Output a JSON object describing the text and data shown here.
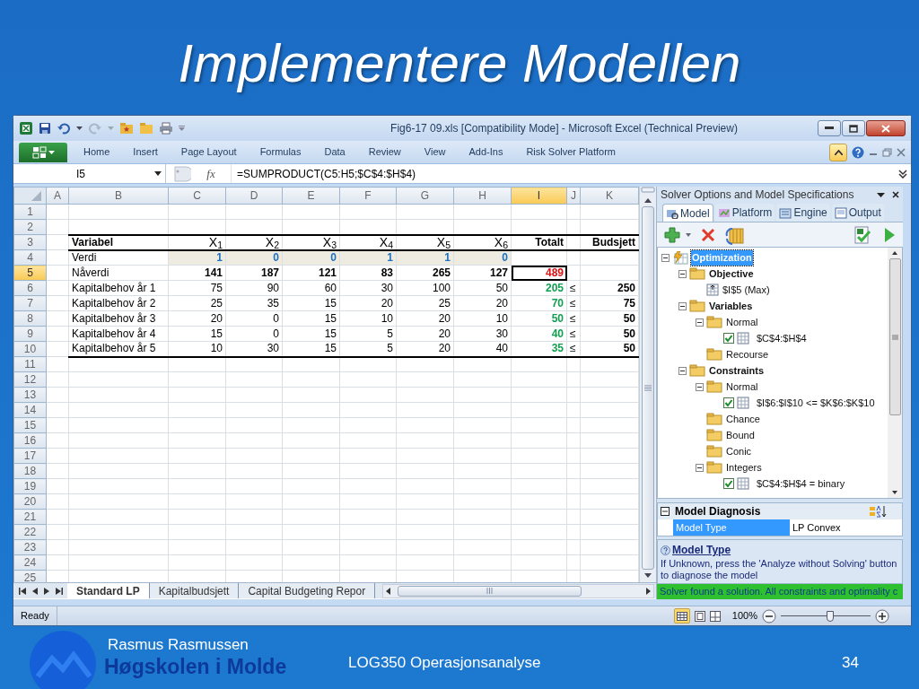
{
  "slide": {
    "title": "Implementere Modellen",
    "author": "Rasmus Rasmussen",
    "logo_text": "Høgskolen i Molde",
    "course": "LOG350 Operasjonsanalyse",
    "page_number": "34"
  },
  "window": {
    "title": "Fig6-17 09.xls  [Compatibility Mode]  -  Microsoft Excel (Technical Preview)"
  },
  "ribbon_tabs": [
    "Home",
    "Insert",
    "Page Layout",
    "Formulas",
    "Data",
    "Review",
    "View",
    "Add-Ins",
    "Risk Solver Platform"
  ],
  "formula_bar": {
    "name_box": "I5",
    "function_label": "fx",
    "formula": "=SUMPRODUCT(C5:H5;$C$4:$H$4)"
  },
  "sheet": {
    "columns": [
      {
        "label": "A",
        "selected": false
      },
      {
        "label": "B",
        "selected": false
      },
      {
        "label": "C",
        "selected": false
      },
      {
        "label": "D",
        "selected": false
      },
      {
        "label": "E",
        "selected": false
      },
      {
        "label": "F",
        "selected": false
      },
      {
        "label": "G",
        "selected": false
      },
      {
        "label": "H",
        "selected": false
      },
      {
        "label": "I",
        "selected": true
      },
      {
        "label": "J",
        "selected": false
      },
      {
        "label": "K",
        "selected": false
      }
    ],
    "rows": [
      {
        "number": "1",
        "selected": false,
        "kind": "empty"
      },
      {
        "number": "2",
        "selected": false,
        "kind": "empty"
      },
      {
        "number": "3",
        "selected": false,
        "kind": "header",
        "label": "Variabel",
        "values": [
          "X$_{1}$",
          "X$_{2}$",
          "X$_{3}$",
          "X$_{4}$",
          "X$_{5}$",
          "X$_{6}$"
        ],
        "total": "Totalt",
        "budget": "Budsjett"
      },
      {
        "number": "4",
        "selected": false,
        "kind": "input",
        "label": "Verdi",
        "values": [
          "1",
          "0",
          "0",
          "1",
          "1",
          "0"
        ]
      },
      {
        "number": "5",
        "selected": true,
        "kind": "objective",
        "label": "Nåverdi",
        "values": [
          "141",
          "187",
          "121",
          "83",
          "265",
          "127"
        ],
        "total": "489"
      },
      {
        "number": "6",
        "selected": false,
        "kind": "constraint",
        "label": "Kapitalbehov år 1",
        "values": [
          "75",
          "90",
          "60",
          "30",
          "100",
          "50"
        ],
        "total": "205",
        "sign": "≤",
        "budget": "250"
      },
      {
        "number": "7",
        "selected": false,
        "kind": "constraint",
        "label": "Kapitalbehov år 2",
        "values": [
          "25",
          "35",
          "15",
          "20",
          "25",
          "20"
        ],
        "total": "70",
        "sign": "≤",
        "budget": "75"
      },
      {
        "number": "8",
        "selected": false,
        "kind": "constraint",
        "label": "Kapitalbehov år 3",
        "values": [
          "20",
          "0",
          "15",
          "10",
          "20",
          "10"
        ],
        "total": "50",
        "sign": "≤",
        "budget": "50"
      },
      {
        "number": "9",
        "selected": false,
        "kind": "constraint",
        "label": "Kapitalbehov år 4",
        "values": [
          "15",
          "0",
          "15",
          "5",
          "20",
          "30"
        ],
        "total": "40",
        "sign": "≤",
        "budget": "50"
      },
      {
        "number": "10",
        "selected": false,
        "kind": "constraint",
        "label": "Kapitalbehov år 5",
        "values": [
          "10",
          "30",
          "15",
          "5",
          "20",
          "40"
        ],
        "total": "35",
        "sign": "≤",
        "budget": "50"
      },
      {
        "number": "11",
        "selected": false,
        "kind": "empty"
      },
      {
        "number": "12",
        "selected": false,
        "kind": "empty"
      },
      {
        "number": "13",
        "selected": false,
        "kind": "empty"
      },
      {
        "number": "14",
        "selected": false,
        "kind": "empty"
      },
      {
        "number": "15",
        "selected": false,
        "kind": "empty"
      },
      {
        "number": "16",
        "selected": false,
        "kind": "empty"
      },
      {
        "number": "17",
        "selected": false,
        "kind": "empty"
      },
      {
        "number": "18",
        "selected": false,
        "kind": "empty"
      },
      {
        "number": "19",
        "selected": false,
        "kind": "empty"
      },
      {
        "number": "20",
        "selected": false,
        "kind": "empty"
      },
      {
        "number": "21",
        "selected": false,
        "kind": "empty"
      },
      {
        "number": "22",
        "selected": false,
        "kind": "empty"
      },
      {
        "number": "23",
        "selected": false,
        "kind": "empty"
      },
      {
        "number": "24",
        "selected": false,
        "kind": "empty"
      },
      {
        "number": "25",
        "selected": false,
        "kind": "empty"
      }
    ],
    "sheet_tabs": [
      {
        "label": "Standard LP",
        "selected": true
      },
      {
        "label": "Kapitalbudsjett",
        "selected": false
      },
      {
        "label": "Capital Budgeting Repor",
        "selected": false
      }
    ]
  },
  "solver_panel": {
    "title": "Solver Options and Model Specifications",
    "tabs": [
      {
        "label": "Model",
        "selected": true
      },
      {
        "label": "Platform",
        "selected": false
      },
      {
        "label": "Engine",
        "selected": false
      },
      {
        "label": "Output",
        "selected": false
      }
    ],
    "tree": [
      {
        "label": "Optimization",
        "kind": "model",
        "selected": true,
        "expanded": true,
        "children": [
          {
            "label": "Objective",
            "kind": "folder",
            "selected": false,
            "expanded": true,
            "children": [
              {
                "label": "$I$5 (Max)",
                "kind": "objective",
                "selected": false
              }
            ]
          },
          {
            "label": "Variables",
            "kind": "folder",
            "selected": false,
            "expanded": true,
            "children": [
              {
                "label": "Normal",
                "kind": "folder",
                "selected": false,
                "expanded": true,
                "children": [
                  {
                    "label": "$C$4:$H$4",
                    "kind": "range",
                    "selected": false,
                    "checked": true
                  }
                ]
              },
              {
                "label": "Recourse",
                "kind": "folder",
                "selected": false
              }
            ]
          },
          {
            "label": "Constraints",
            "kind": "folder",
            "selected": false,
            "expanded": true,
            "children": [
              {
                "label": "Normal",
                "kind": "folder",
                "selected": false,
                "expanded": true,
                "children": [
                  {
                    "label": "$I$6:$I$10 <= $K$6:$K$10",
                    "kind": "range",
                    "selected": false,
                    "checked": true
                  }
                ]
              },
              {
                "label": "Chance",
                "kind": "folder",
                "selected": false
              },
              {
                "label": "Bound",
                "kind": "folder",
                "selected": false
              },
              {
                "label": "Conic",
                "kind": "folder",
                "selected": false
              },
              {
                "label": "Integers",
                "kind": "folder",
                "selected": false,
                "expanded": true,
                "children": [
                  {
                    "label": "$C$4:$H$4 = binary",
                    "kind": "range",
                    "selected": false,
                    "checked": true
                  }
                ]
              }
            ]
          }
        ]
      }
    ],
    "diagnosis": {
      "title": "Model Diagnosis",
      "rows": [
        {
          "label": "Model Type",
          "value": "LP Convex",
          "selected": true
        }
      ]
    },
    "help": {
      "title": "Model Type",
      "text": "If Unknown, press the 'Analyze without Solving' button to diagnose the model"
    },
    "message": "Solver found a solution.  All constraints and optimality c"
  },
  "status_bar": {
    "text": "Ready",
    "zoom": "100%",
    "zoom_slider": {
      "level": 0.55
    }
  }
}
